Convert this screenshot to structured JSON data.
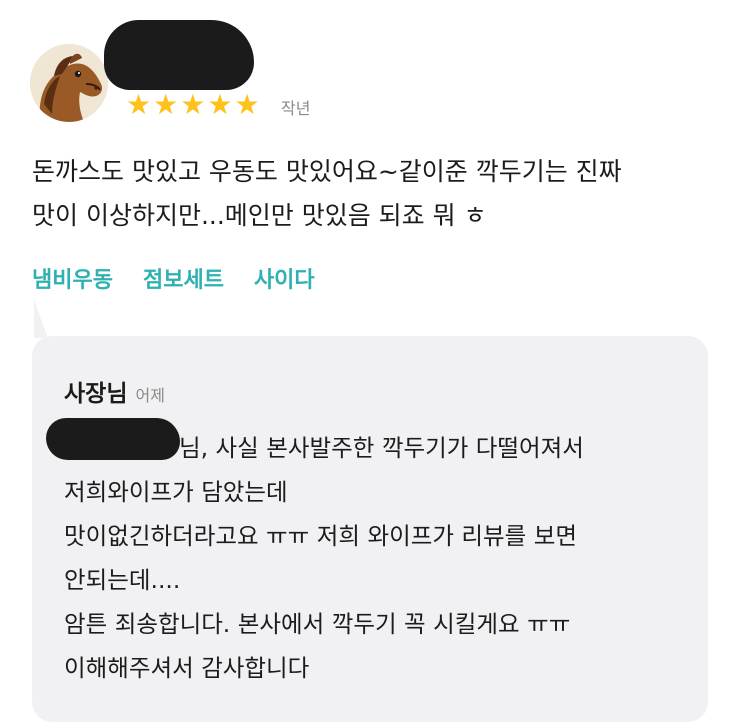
{
  "review": {
    "rating": 5,
    "stars": [
      "★",
      "★",
      "★",
      "★",
      "★"
    ],
    "time": "작년",
    "body_lines": [
      "돈까스도 맛있고 우동도 맛있어요~같이준 깍두기는 진짜",
      "맛이 이상하지만...메인만 맛있음 되죠 뭐 ㅎ"
    ],
    "tags": [
      "냄비우동",
      "점보세트",
      "사이다"
    ],
    "colors": {
      "star": "#ffc21c",
      "tag": "#2fb1b1"
    },
    "avatar_icon": "horse-icon"
  },
  "reply": {
    "owner_label": "사장님",
    "time": "어제",
    "lines": [
      "님, 사실 본사발주한 깍두기가 다떨어져서",
      "저희와이프가 담았는데",
      "맛이없긴하더라고요 ㅠㅠ 저희 와이프가 리뷰를 보면",
      "안되는데....",
      "암튼 죄송합니다. 본사에서 깍두기 꼭 시킬게요 ㅠㅠ",
      "이해해주셔서 감사합니다"
    ],
    "background": "#f1f1f3"
  }
}
